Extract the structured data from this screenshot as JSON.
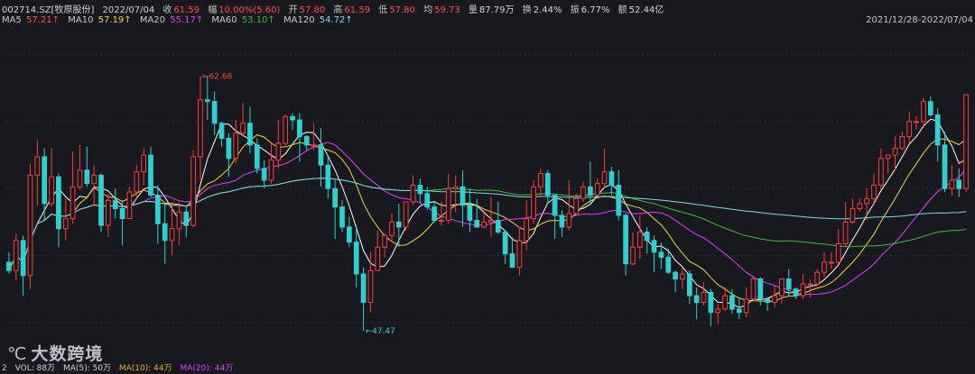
{
  "header": {
    "code_name": "002714.SZ[牧原股份]",
    "date": "2022/07/04",
    "close_label": "收",
    "close": "61.59",
    "change_label": "幅",
    "change": "10.00%(5.60)",
    "open_label": "开",
    "open": "57.80",
    "high_label": "高",
    "high": "61.59",
    "low_label": "低",
    "low": "57.80",
    "avg_label": "均",
    "avg": "59.73",
    "volume_label": "量",
    "volume": "87.79万",
    "turnover_label": "换",
    "turnover": "2.44%",
    "amplitude_label": "振",
    "amplitude": "6.77%",
    "amount_label": "额",
    "amount": "52.44亿"
  },
  "ma_legend": [
    {
      "label": "MA5",
      "value": "57.21↑",
      "color": "#ffffff"
    },
    {
      "label": "MA10",
      "value": "57.19↑",
      "color": "#f5d23c"
    },
    {
      "label": "MA20",
      "value": "55.17↑",
      "color": "#e040fb"
    },
    {
      "label": "MA60",
      "value": "53.10↑",
      "color": "#3dbb3d"
    },
    {
      "label": "MA120",
      "value": "54.72↑",
      "color": "#7fd8e6"
    }
  ],
  "date_range": "2021/12/28-2022/07/04",
  "annotations": {
    "high": "62.68",
    "low": "47.47"
  },
  "volume_row": {
    "prefix": "2",
    "vol": "VOL: 88万",
    "ma5": "MA(5): 50万",
    "ma10": "MA(10): 44万",
    "ma20": "MA(20): 44万"
  },
  "logo": {
    "mark": "℃",
    "text": "大数跨境"
  },
  "colors": {
    "up": "#ff3b3b",
    "down": "#2fd0d0",
    "background": "#17191e",
    "grid": "#2a2d33"
  },
  "chart_data": {
    "type": "candlestick",
    "ylim": [
      46,
      65
    ],
    "candles": [
      [
        51.6,
        51.1,
        50.9,
        52.2
      ],
      [
        51.1,
        52.9,
        50.5,
        53.3
      ],
      [
        52.9,
        50.8,
        49.6,
        53.2
      ],
      [
        50.8,
        56.8,
        50.0,
        57.5
      ],
      [
        56.8,
        57.9,
        55.0,
        58.9
      ],
      [
        57.9,
        55.1,
        54.1,
        58.4
      ],
      [
        55.1,
        56.7,
        54.9,
        58.4
      ],
      [
        56.7,
        53.6,
        52.5,
        56.9
      ],
      [
        53.6,
        54.2,
        52.9,
        55.4
      ],
      [
        54.2,
        56.1,
        53.9,
        58.2
      ],
      [
        56.1,
        57.1,
        55.9,
        58.6
      ],
      [
        57.1,
        56.3,
        56.1,
        58.5
      ],
      [
        56.3,
        56.8,
        54.9,
        57.4
      ],
      [
        56.8,
        53.8,
        53.4,
        56.9
      ],
      [
        53.8,
        55.3,
        53.1,
        55.7
      ],
      [
        55.3,
        54.8,
        54.2,
        56.0
      ],
      [
        54.8,
        54.2,
        52.6,
        55.3
      ],
      [
        54.2,
        55.8,
        54.2,
        56.1
      ],
      [
        55.8,
        57.0,
        55.4,
        57.4
      ],
      [
        57.0,
        58.0,
        56.2,
        58.4
      ],
      [
        58.0,
        55.6,
        55.5,
        58.5
      ],
      [
        55.6,
        53.9,
        52.7,
        56.2
      ],
      [
        53.9,
        52.9,
        51.5,
        55.1
      ],
      [
        52.9,
        53.6,
        52.0,
        55.2
      ],
      [
        53.6,
        54.6,
        52.6,
        55.2
      ],
      [
        54.6,
        53.8,
        53.1,
        54.9
      ],
      [
        53.8,
        57.9,
        53.7,
        58.3
      ],
      [
        57.9,
        61.3,
        56.5,
        62.7
      ],
      [
        61.3,
        61.2,
        60.1,
        62.7
      ],
      [
        61.2,
        59.9,
        59.2,
        61.8
      ],
      [
        59.9,
        59.0,
        58.5,
        60.0
      ],
      [
        59.0,
        57.8,
        56.7,
        59.3
      ],
      [
        57.8,
        59.3,
        57.5,
        60.1
      ],
      [
        59.3,
        59.9,
        59.1,
        61.1
      ],
      [
        59.9,
        58.6,
        58.1,
        60.9
      ],
      [
        58.6,
        57.2,
        56.9,
        59.0
      ],
      [
        57.2,
        56.5,
        56.0,
        57.7
      ],
      [
        56.5,
        57.7,
        56.3,
        58.7
      ],
      [
        57.7,
        58.7,
        57.2,
        60.1
      ],
      [
        58.7,
        60.3,
        58.6,
        60.4
      ],
      [
        60.3,
        60.1,
        59.5,
        60.5
      ],
      [
        60.1,
        59.1,
        57.6,
        60.5
      ],
      [
        59.1,
        58.6,
        58.3,
        59.2
      ],
      [
        58.6,
        58.6,
        58.3,
        59.9
      ],
      [
        58.6,
        57.4,
        56.1,
        59.6
      ],
      [
        57.4,
        56.0,
        55.4,
        57.9
      ],
      [
        56.0,
        54.9,
        53.0,
        56.5
      ],
      [
        54.9,
        53.7,
        53.4,
        55.3
      ],
      [
        53.7,
        52.8,
        52.5,
        54.3
      ],
      [
        52.8,
        50.9,
        50.1,
        53.8
      ],
      [
        50.9,
        49.2,
        47.5,
        51.3
      ],
      [
        49.2,
        51.1,
        48.6,
        52.2
      ],
      [
        51.1,
        52.5,
        51.1,
        53.5
      ],
      [
        52.5,
        53.2,
        51.9,
        53.3
      ],
      [
        53.2,
        54.0,
        52.8,
        54.5
      ],
      [
        54.0,
        53.7,
        52.5,
        55.1
      ],
      [
        53.7,
        55.2,
        53.5,
        55.2
      ],
      [
        55.2,
        56.2,
        55.0,
        56.8
      ],
      [
        56.2,
        55.7,
        55.1,
        56.6
      ],
      [
        55.7,
        54.9,
        54.7,
        56.1
      ],
      [
        54.9,
        54.1,
        54.0,
        55.2
      ],
      [
        54.1,
        54.1,
        53.8,
        55.2
      ],
      [
        54.1,
        56.0,
        53.9,
        56.9
      ],
      [
        56.0,
        56.1,
        54.6,
        56.8
      ],
      [
        56.1,
        55.0,
        53.7,
        57.1
      ],
      [
        55.0,
        54.1,
        53.4,
        56.0
      ],
      [
        54.1,
        53.7,
        53.7,
        55.4
      ],
      [
        53.7,
        54.0,
        53.6,
        54.7
      ],
      [
        54.0,
        54.1,
        53.1,
        55.5
      ],
      [
        54.1,
        53.4,
        53.3,
        55.2
      ],
      [
        53.4,
        52.1,
        51.5,
        53.4
      ],
      [
        52.1,
        51.3,
        51.3,
        53.1
      ],
      [
        51.3,
        52.9,
        50.8,
        53.7
      ],
      [
        52.9,
        54.2,
        52.3,
        55.3
      ],
      [
        54.2,
        56.1,
        53.9,
        56.5
      ],
      [
        56.1,
        56.9,
        55.5,
        57.2
      ],
      [
        56.9,
        55.6,
        55.2,
        57.1
      ],
      [
        55.6,
        54.4,
        53.0,
        55.6
      ],
      [
        54.4,
        53.7,
        53.1,
        54.7
      ],
      [
        53.7,
        54.5,
        53.5,
        56.5
      ],
      [
        54.5,
        55.4,
        54.4,
        55.7
      ],
      [
        55.4,
        56.1,
        55.2,
        56.4
      ],
      [
        56.1,
        55.6,
        55.0,
        57.6
      ],
      [
        55.6,
        56.3,
        55.6,
        56.6
      ],
      [
        56.3,
        57.0,
        56.0,
        58.4
      ],
      [
        57.0,
        56.2,
        55.6,
        57.3
      ],
      [
        56.2,
        54.4,
        54.1,
        57.1
      ],
      [
        54.4,
        51.5,
        50.8,
        54.5
      ],
      [
        51.5,
        52.5,
        51.4,
        53.4
      ],
      [
        52.5,
        53.4,
        51.8,
        54.4
      ],
      [
        53.4,
        52.9,
        52.1,
        53.7
      ],
      [
        52.9,
        52.2,
        51.0,
        53.2
      ],
      [
        52.2,
        51.9,
        51.2,
        52.8
      ],
      [
        51.9,
        51.0,
        50.9,
        52.4
      ],
      [
        51.0,
        50.6,
        49.8,
        51.1
      ],
      [
        50.6,
        50.9,
        50.0,
        51.3
      ],
      [
        50.9,
        49.6,
        49.1,
        51.1
      ],
      [
        49.6,
        49.2,
        48.2,
        50.1
      ],
      [
        49.2,
        49.8,
        49.0,
        50.4
      ],
      [
        49.8,
        48.6,
        47.8,
        50.0
      ],
      [
        48.6,
        48.8,
        47.9,
        49.1
      ],
      [
        48.8,
        49.6,
        48.7,
        50.1
      ],
      [
        49.6,
        48.8,
        48.5,
        50.0
      ],
      [
        48.8,
        48.6,
        48.2,
        49.4
      ],
      [
        48.6,
        49.4,
        48.3,
        50.1
      ],
      [
        49.4,
        50.6,
        49.3,
        50.8
      ],
      [
        50.6,
        49.4,
        49.0,
        50.7
      ],
      [
        49.4,
        49.2,
        48.7,
        49.5
      ],
      [
        49.2,
        49.6,
        48.9,
        50.2
      ],
      [
        49.6,
        50.6,
        49.1,
        50.6
      ],
      [
        50.6,
        50.0,
        49.6,
        51.2
      ],
      [
        50.0,
        49.6,
        49.4,
        50.1
      ],
      [
        49.6,
        50.3,
        49.4,
        50.9
      ],
      [
        50.3,
        50.3,
        49.5,
        50.6
      ],
      [
        50.3,
        51.0,
        50.2,
        51.2
      ],
      [
        51.0,
        51.6,
        50.7,
        52.2
      ],
      [
        51.6,
        51.6,
        51.2,
        52.2
      ],
      [
        51.6,
        52.7,
        51.5,
        53.6
      ],
      [
        52.7,
        54.0,
        52.5,
        55.2
      ],
      [
        54.0,
        54.8,
        53.9,
        55.4
      ],
      [
        54.8,
        55.1,
        54.6,
        55.4
      ],
      [
        55.1,
        55.4,
        54.1,
        56.0
      ],
      [
        55.4,
        56.2,
        55.1,
        56.9
      ],
      [
        56.2,
        57.8,
        55.9,
        58.4
      ],
      [
        57.8,
        58.0,
        56.9,
        58.0
      ],
      [
        58.0,
        58.4,
        57.1,
        59.1
      ],
      [
        58.4,
        59.1,
        58.3,
        59.4
      ],
      [
        59.1,
        60.0,
        58.7,
        60.6
      ],
      [
        60.0,
        60.0,
        59.5,
        60.3
      ],
      [
        60.0,
        61.2,
        59.6,
        61.4
      ],
      [
        61.2,
        60.4,
        60.3,
        61.5
      ],
      [
        60.4,
        58.6,
        57.6,
        60.8
      ],
      [
        58.6,
        56.0,
        55.8,
        59.4
      ],
      [
        56.0,
        56.5,
        55.6,
        57.4
      ],
      [
        56.5,
        56.0,
        55.5,
        57.2
      ],
      [
        56.0,
        61.6,
        55.8,
        61.6
      ]
    ],
    "ma_periods": [
      5,
      10,
      20,
      60,
      120
    ],
    "volume_label_series": [
      "VOL",
      "MA(5)",
      "MA(10)",
      "MA(20)"
    ]
  }
}
